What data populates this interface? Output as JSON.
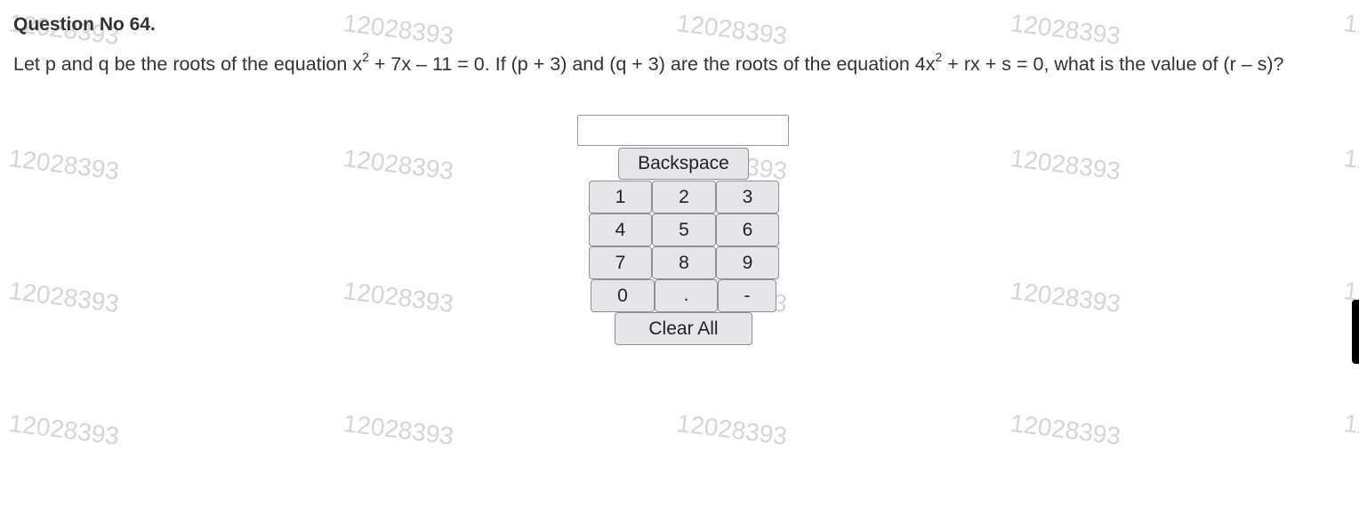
{
  "watermark": {
    "text": "12028393",
    "color": "#d6d6d6"
  },
  "question": {
    "title": "Question No 64.",
    "text_parts": [
      "Let p and q be the roots of the equation x",
      "2",
      " + 7x – 11 = 0. If (p + 3) and (q + 3) are the roots of the equation 4x",
      "2",
      " + rx + s = 0, what is the value of (r – s)?"
    ]
  },
  "answer_input": {
    "value": "",
    "placeholder": ""
  },
  "keypad": {
    "backspace_label": "Backspace",
    "keys": [
      "1",
      "2",
      "3",
      "4",
      "5",
      "6",
      "7",
      "8",
      "9",
      "0",
      ".",
      "-"
    ],
    "clear_label": "Clear All"
  }
}
